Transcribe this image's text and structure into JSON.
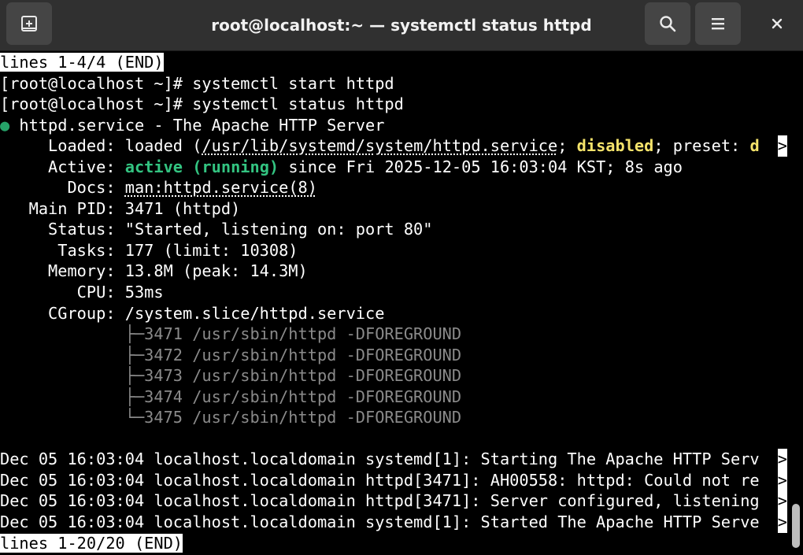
{
  "window": {
    "title": "root@localhost:~ — systemctl status httpd",
    "new_tab_icon": "new-tab-icon",
    "search_icon": "search-icon",
    "menu_icon": "hamburger-menu-icon",
    "close_icon": "close-icon"
  },
  "colors": {
    "terminal_bg": "#000000",
    "titlebar_bg": "#303030",
    "active_green": "#33c481",
    "disabled_yellow": "#f5e36b",
    "cgroup_gray": "#8a8a8a"
  },
  "terminal": {
    "pager_top": "lines 1-4/4 (END)",
    "cmd1": "[root@localhost ~]# systemctl start httpd",
    "cmd2": "[root@localhost ~]# systemctl status httpd",
    "service_dot": "●",
    "service_header": " httpd.service - The Apache HTTP Server",
    "loaded_label": "     Loaded: ",
    "loaded_pre": "loaded (",
    "loaded_path": "/usr/lib/systemd/system/httpd.service",
    "loaded_sep": "; ",
    "loaded_disabled": "disabled",
    "loaded_preset": "; preset: ",
    "loaded_cut": "d",
    "active_label": "     Active: ",
    "active_state": "active (running)",
    "active_since": " since Fri 2025-12-05 16:03:04 KST; 8s ago",
    "docs_label": "       Docs: ",
    "docs_value": "man:httpd.service(8)",
    "mainpid_line": "   Main PID: 3471 (httpd)",
    "status_line": "     Status: \"Started, listening on: port 80\"",
    "tasks_line": "      Tasks: 177 (limit: 10308)",
    "memory_line": "     Memory: 13.8M (peak: 14.3M)",
    "cpu_line": "        CPU: 53ms",
    "cgroup_line": "     CGroup: /system.slice/httpd.service",
    "tree": [
      "             ├─3471 /usr/sbin/httpd -DFOREGROUND",
      "             ├─3472 /usr/sbin/httpd -DFOREGROUND",
      "             ├─3473 /usr/sbin/httpd -DFOREGROUND",
      "             ├─3474 /usr/sbin/httpd -DFOREGROUND",
      "             └─3475 /usr/sbin/httpd -DFOREGROUND"
    ],
    "logs": [
      "Dec 05 16:03:04 localhost.localdomain systemd[1]: Starting The Apache HTTP Serv",
      "Dec 05 16:03:04 localhost.localdomain httpd[3471]: AH00558: httpd: Could not re",
      "Dec 05 16:03:04 localhost.localdomain httpd[3471]: Server configured, listening",
      "Dec 05 16:03:04 localhost.localdomain systemd[1]: Started The Apache HTTP Serve"
    ],
    "truncation_marker": ">",
    "pager_bottom": "lines 1-20/20 (END)"
  }
}
